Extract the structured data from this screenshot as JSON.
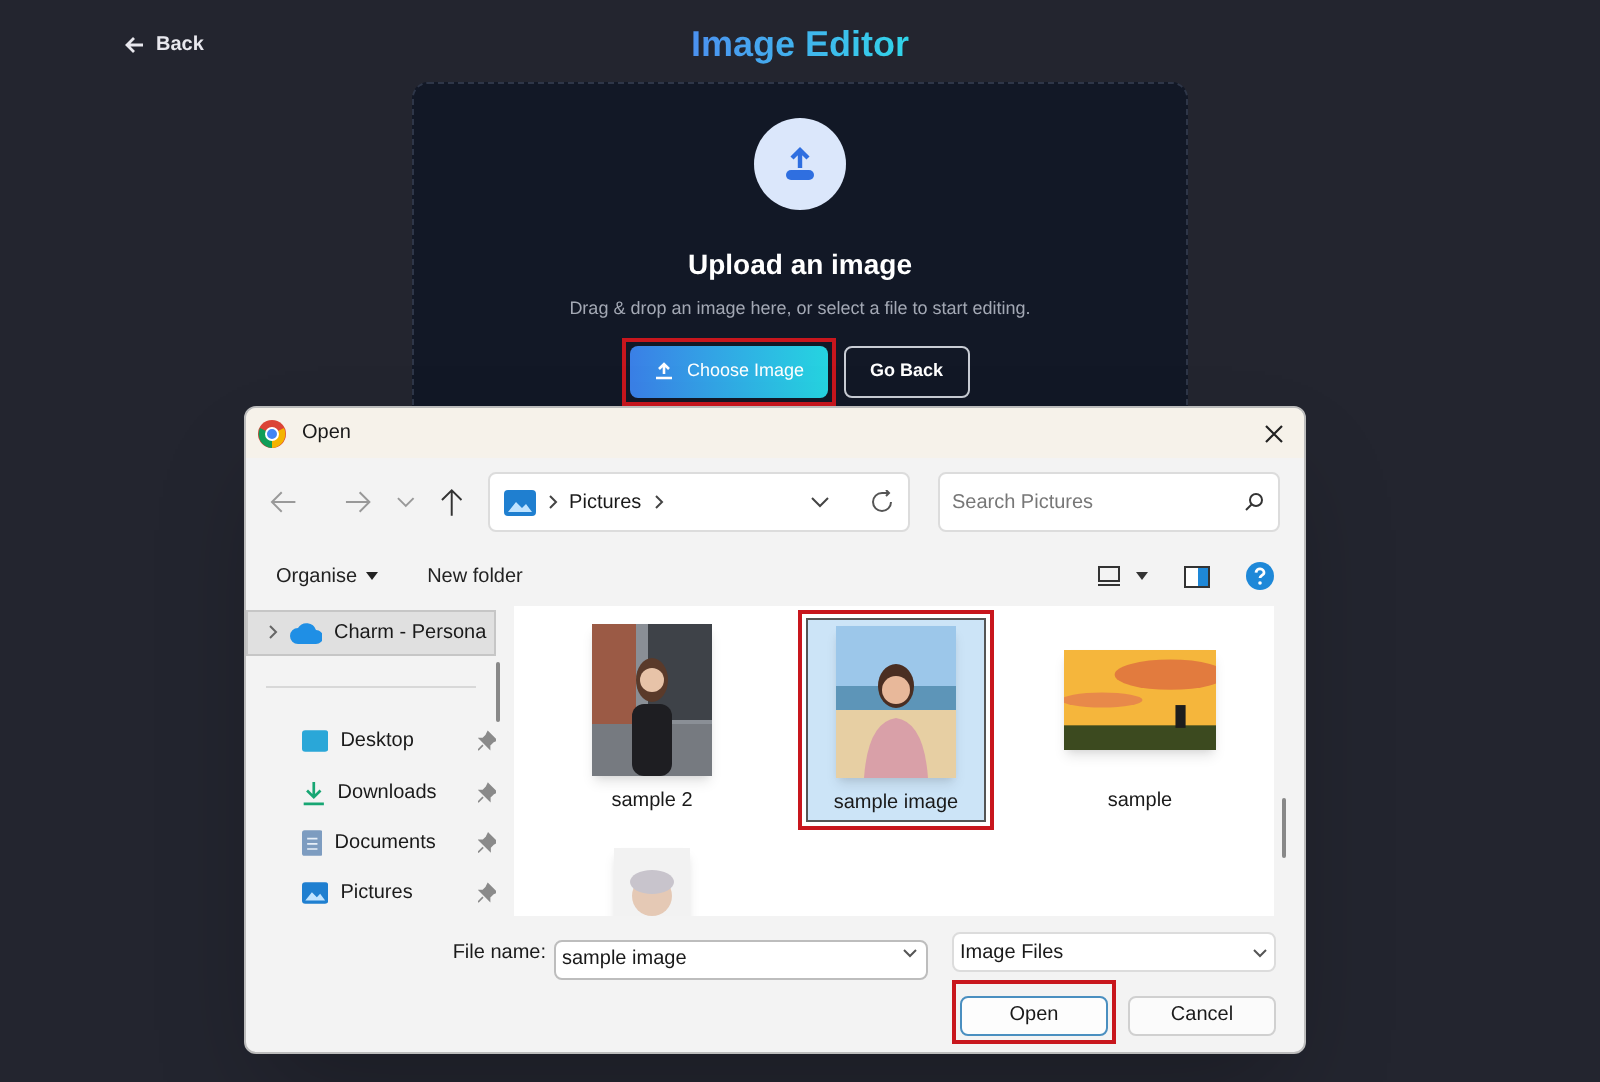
{
  "page": {
    "back_link": "Back",
    "title": "Image Editor"
  },
  "upload_card": {
    "heading": "Upload an image",
    "description": "Drag & drop an image here, or select a file to start editing.",
    "buttons": [
      {
        "label": "Choose Image",
        "kind": "primary",
        "highlighted": true
      },
      {
        "label": "Go Back",
        "kind": "outline",
        "highlighted": false
      }
    ]
  },
  "dialog": {
    "title": "Open",
    "breadcrumb": [
      "Pictures"
    ],
    "search": {
      "placeholder": "Search Pictures"
    },
    "toolbar": {
      "organise": "Organise",
      "new_folder": "New folder"
    },
    "sidebar": {
      "items": [
        {
          "label": "Charm - Persona",
          "kind": "cloud",
          "selected": true,
          "pinned": false
        },
        {
          "label": "Desktop",
          "kind": "desktop",
          "selected": false,
          "pinned": true
        },
        {
          "label": "Downloads",
          "kind": "downloads",
          "selected": false,
          "pinned": true
        },
        {
          "label": "Documents",
          "kind": "documents",
          "selected": false,
          "pinned": true
        },
        {
          "label": "Pictures",
          "kind": "pictures",
          "selected": false,
          "pinned": true
        }
      ]
    },
    "files": [
      {
        "name": "sample 2",
        "kind": "city",
        "selected": false,
        "highlighted": false
      },
      {
        "name": "sample image",
        "kind": "beach",
        "selected": true,
        "highlighted": true
      },
      {
        "name": "sample",
        "kind": "sunset",
        "selected": false,
        "highlighted": false
      },
      {
        "kind": "studio",
        "selected": false,
        "highlighted": false
      }
    ],
    "file_name": {
      "label": "File name:",
      "value": "sample image"
    },
    "file_type": "Image Files",
    "buttons": [
      {
        "label": "Open",
        "kind": "primary",
        "highlighted": true
      },
      {
        "label": "Cancel",
        "kind": "secondary",
        "highlighted": false
      }
    ]
  }
}
